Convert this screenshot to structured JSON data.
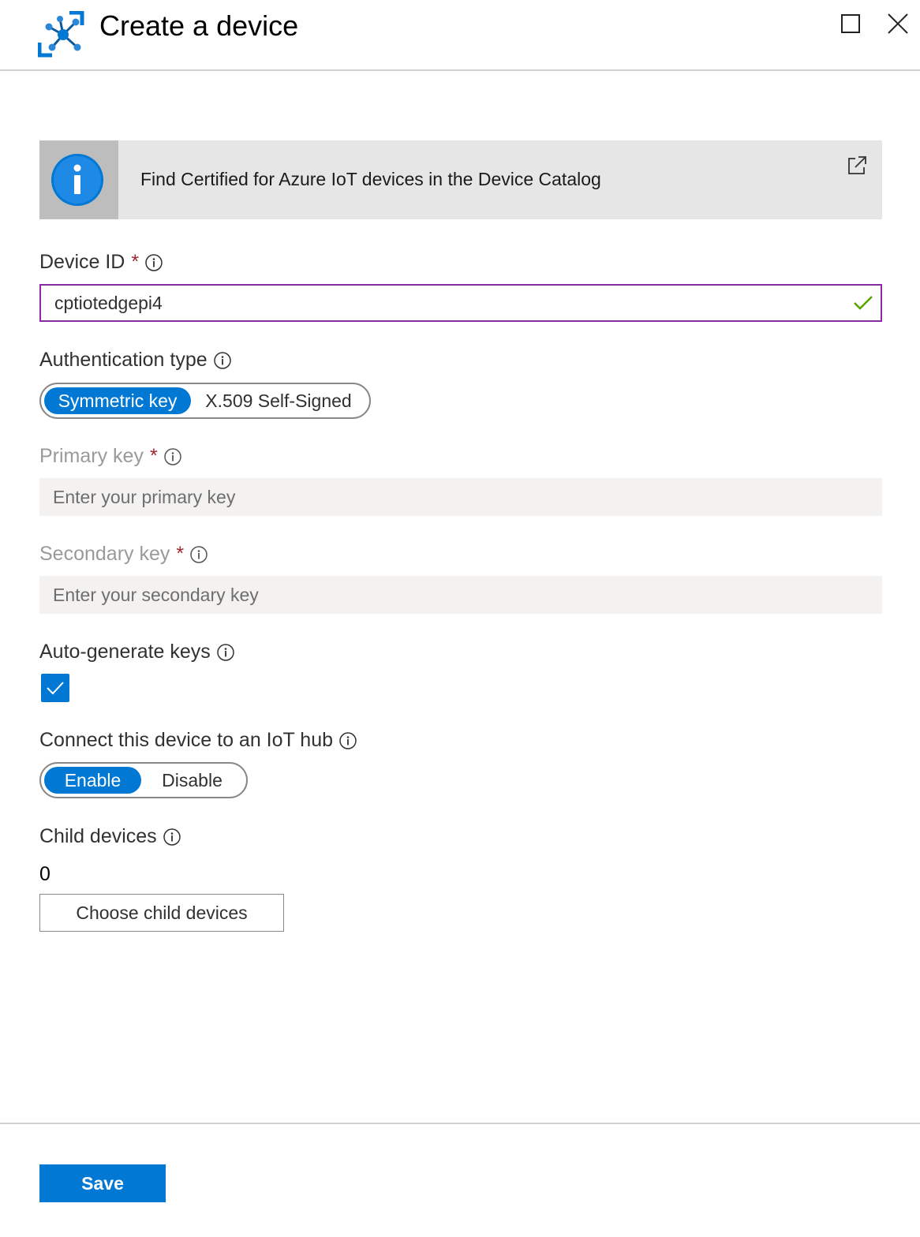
{
  "header": {
    "title": "Create a device",
    "icon": "iot-hub-icon",
    "maximize_icon": "maximize-icon",
    "close_icon": "close-icon"
  },
  "banner": {
    "text": "Find Certified for Azure IoT devices in the Device Catalog",
    "icon": "info-icon",
    "link_icon": "external-link-icon"
  },
  "device_id": {
    "label": "Device ID",
    "required_mark": "*",
    "value": "cptiotedgepi4",
    "valid": true
  },
  "auth_type": {
    "label": "Authentication type",
    "options": [
      "Symmetric key",
      "X.509 Self-Signed"
    ],
    "selected": "Symmetric key"
  },
  "primary_key": {
    "label": "Primary key",
    "required_mark": "*",
    "placeholder": "Enter your primary key"
  },
  "secondary_key": {
    "label": "Secondary key",
    "required_mark": "*",
    "placeholder": "Enter your secondary key"
  },
  "auto_generate": {
    "label": "Auto-generate keys",
    "checked": true
  },
  "connect_hub": {
    "label": "Connect this device to an IoT hub",
    "options": [
      "Enable",
      "Disable"
    ],
    "selected": "Enable"
  },
  "child_devices": {
    "label": "Child devices",
    "count": "0",
    "button": "Choose child devices"
  },
  "footer": {
    "save_label": "Save"
  },
  "colors": {
    "accent": "#0078d4",
    "focus_border": "#8a2da5",
    "required": "#a4262c",
    "valid_check": "#57a300"
  }
}
